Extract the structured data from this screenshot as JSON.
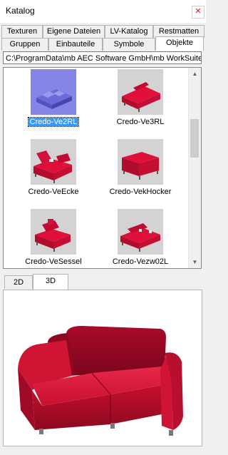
{
  "window": {
    "title": "Katalog",
    "close_icon": "close-icon"
  },
  "tabs_row1": [
    "Texturen",
    "Eigene Dateien",
    "LV-Katalog",
    "Restmatten"
  ],
  "tabs_row2": [
    "Gruppen",
    "Einbauteile",
    "Symbole",
    "Objekte"
  ],
  "active_tab": "Objekte",
  "path": "C:\\ProgramData\\mb AEC Software GmbH\\mb WorkSuite\\",
  "items": [
    {
      "label": "Credo-Ve2RL",
      "selected": true
    },
    {
      "label": "Credo-Ve3RL",
      "selected": false
    },
    {
      "label": "Credo-VeEcke",
      "selected": false
    },
    {
      "label": "Credo-VekHocker",
      "selected": false
    },
    {
      "label": "Credo-VeSessel",
      "selected": false
    },
    {
      "label": "Credo-Vezw02L",
      "selected": false
    }
  ],
  "view_tabs": [
    "2D",
    "3D"
  ],
  "active_view_tab": "3D",
  "colors": {
    "selection": "#3399ff",
    "sofa": "#d0123a",
    "thumb_bg": "#d3d3d3"
  }
}
